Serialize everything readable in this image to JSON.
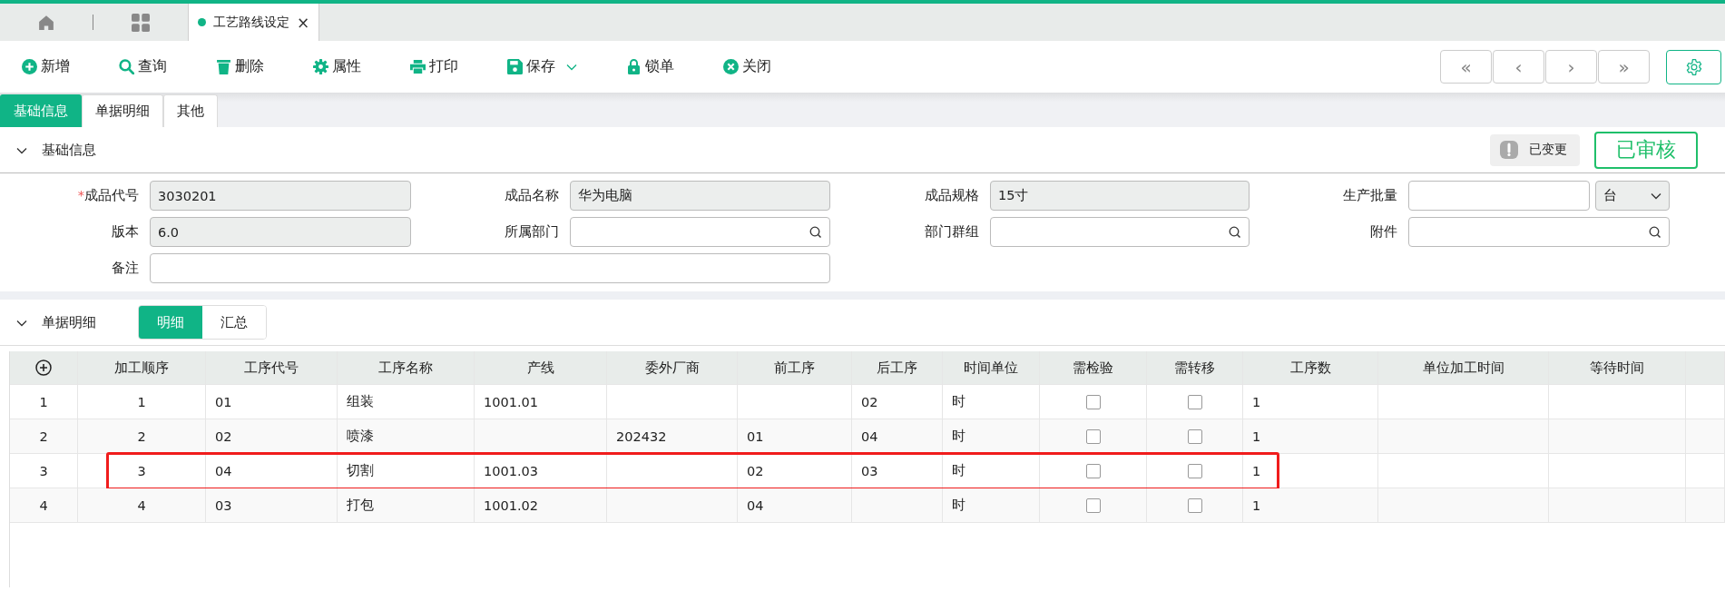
{
  "page_tabs": [
    {
      "kind": "home",
      "selected": false
    },
    {
      "kind": "apps",
      "selected": false
    },
    {
      "kind": "page",
      "label": "工艺路线设定",
      "selected": true,
      "close": "×"
    }
  ],
  "toolbar": [
    {
      "kind": "add",
      "label": "新增"
    },
    {
      "kind": "search",
      "label": "查询"
    },
    {
      "kind": "delete",
      "label": "删除"
    },
    {
      "kind": "settings",
      "label": "属性"
    },
    {
      "kind": "print",
      "label": "打印"
    },
    {
      "kind": "save",
      "label": "保存",
      "dropdown": true
    },
    {
      "kind": "lock",
      "label": "锁单"
    },
    {
      "kind": "close",
      "label": "关闭"
    }
  ],
  "nav_buttons": [
    "«",
    "‹",
    "›",
    "»"
  ],
  "form_tabs": [
    {
      "label": "基础信息",
      "selected": true
    },
    {
      "label": "单据明细",
      "selected": false
    },
    {
      "label": "其他",
      "selected": false
    }
  ],
  "basic_section": {
    "title": "基础信息",
    "expanded": true,
    "changed_badge": "已变更",
    "status": "已审核"
  },
  "required_mark": "*",
  "fields": [
    {
      "label": "成品代号",
      "required": true,
      "value": "3030201",
      "kind": "readonly"
    },
    {
      "label": "成品名称",
      "required": false,
      "value": "华为电脑",
      "kind": "readonly"
    },
    {
      "label": "成品规格",
      "required": false,
      "value": "15寸",
      "kind": "readonly"
    },
    {
      "label": "生产批量",
      "required": false,
      "kind": "unit",
      "unit": "台"
    },
    {
      "label": "版本",
      "required": false,
      "value": "6.0",
      "kind": "readonly"
    },
    {
      "label": "所属部门",
      "required": false,
      "kind": "lookup"
    },
    {
      "label": "部门群组",
      "required": false,
      "kind": "lookup"
    },
    {
      "label": "附件",
      "required": false,
      "kind": "lookup"
    },
    {
      "label": "备注",
      "required": false,
      "kind": "wide"
    }
  ],
  "detail_section": {
    "title": "单据明细",
    "expanded": true,
    "views": [
      {
        "label": "明细",
        "selected": true
      },
      {
        "label": "汇总",
        "selected": false
      }
    ]
  },
  "table": {
    "columns": [
      "加工顺序",
      "工序代号",
      "工序名称",
      "产线",
      "委外厂商",
      "前工序",
      "后工序",
      "时间单位",
      "需检验",
      "需转移",
      "工序数",
      "单位加工时间",
      "等待时间"
    ],
    "rows": [
      {
        "index": "1",
        "seq": "1",
        "code": "01",
        "name": "组装",
        "line": "1001.01",
        "next": "02",
        "unit": "时",
        "inspect": false,
        "transfer": false,
        "count": "1",
        "highlighted": false
      },
      {
        "index": "2",
        "seq": "2",
        "code": "02",
        "name": "喷漆",
        "vendor": "202432",
        "prev": "01",
        "next": "04",
        "unit": "时",
        "inspect": false,
        "transfer": false,
        "count": "1",
        "highlighted": false
      },
      {
        "index": "3",
        "seq": "3",
        "code": "04",
        "name": "切割",
        "line": "1001.03",
        "prev": "02",
        "next": "03",
        "unit": "时",
        "inspect": false,
        "transfer": false,
        "count": "1",
        "highlighted": true
      },
      {
        "index": "4",
        "seq": "4",
        "code": "03",
        "name": "打包",
        "line": "1001.02",
        "prev": "04",
        "unit": "时",
        "inspect": false,
        "transfer": false,
        "count": "1",
        "highlighted": false
      }
    ]
  }
}
